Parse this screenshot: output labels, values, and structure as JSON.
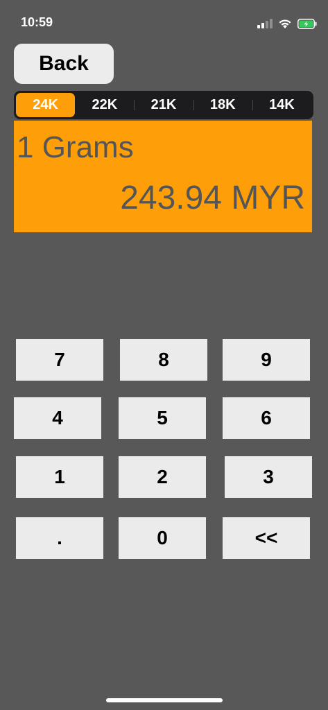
{
  "status_bar": {
    "time": "10:59",
    "icons": [
      "signal-icon",
      "wifi-icon",
      "battery-charging-icon"
    ],
    "battery_color": "#34c759"
  },
  "back_label": "Back",
  "karat_options": [
    "24K",
    "22K",
    "21K",
    "18K",
    "14K"
  ],
  "selected_karat": "24K",
  "display": {
    "amount": "1 Grams",
    "result": "243.94 MYR"
  },
  "keypad": {
    "k7": "7",
    "k8": "8",
    "k9": "9",
    "k4": "4",
    "k5": "5",
    "k6": "6",
    "k1": "1",
    "k2": "2",
    "k3": "3",
    "kdot": ".",
    "k0": "0",
    "kback": "<<"
  },
  "colors": {
    "background": "#585858",
    "accent": "#fe9f0a",
    "segment_bg": "#1c1c1e",
    "key_bg": "#ebebeb",
    "display_text": "#555555"
  }
}
